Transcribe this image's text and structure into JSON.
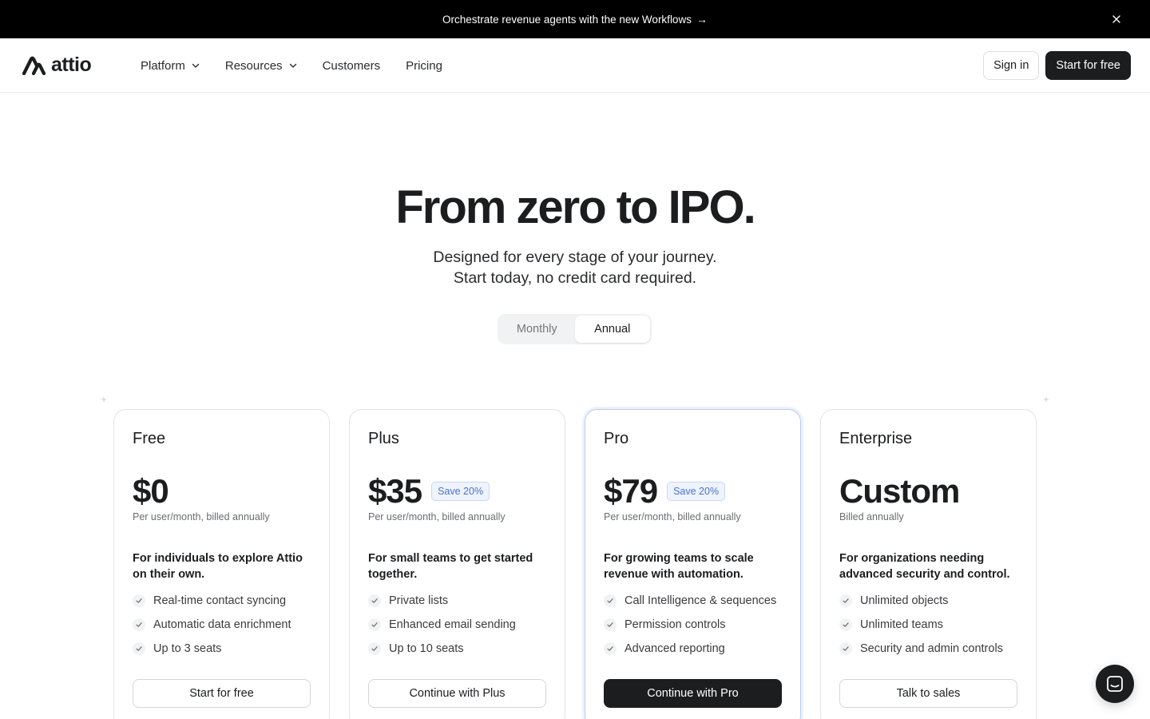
{
  "announcement": {
    "text": "Orchestrate revenue agents with the new Workflows",
    "arrow": "→"
  },
  "nav": {
    "logo_text": "attio",
    "items": [
      {
        "label": "Platform",
        "dropdown": true
      },
      {
        "label": "Resources",
        "dropdown": true
      },
      {
        "label": "Customers",
        "dropdown": false
      },
      {
        "label": "Pricing",
        "dropdown": false
      }
    ],
    "sign_in": "Sign in",
    "start_free": "Start for free"
  },
  "hero": {
    "title": "From zero to IPO.",
    "subtitle_line1": "Designed for every stage of your journey.",
    "subtitle_line2": "Start today, no credit card required."
  },
  "billing_toggle": {
    "options": [
      "Monthly",
      "Annual"
    ],
    "selected": "Annual"
  },
  "plans": [
    {
      "name": "Free",
      "price": "$0",
      "badge": "",
      "billing": "Per user/month, billed annually",
      "description": "For individuals to explore Attio on their own.",
      "features": [
        "Real-time contact syncing",
        "Automatic data enrichment",
        "Up to 3 seats"
      ],
      "cta": "Start for free",
      "featured": false
    },
    {
      "name": "Plus",
      "price": "$35",
      "badge": "Save 20%",
      "billing": "Per user/month, billed annually",
      "description": "For small teams to get started together.",
      "features": [
        "Private lists",
        "Enhanced email sending",
        "Up to 10 seats"
      ],
      "cta": "Continue with Plus",
      "featured": false
    },
    {
      "name": "Pro",
      "price": "$79",
      "badge": "Save 20%",
      "billing": "Per user/month, billed annually",
      "description": "For growing teams to scale revenue with automation.",
      "features": [
        "Call Intelligence & sequences",
        "Permission controls",
        "Advanced reporting"
      ],
      "cta": "Continue with Pro",
      "featured": true
    },
    {
      "name": "Enterprise",
      "price": "Custom",
      "badge": "",
      "billing": "Billed annually",
      "description": "For organizations needing advanced security and control.",
      "features": [
        "Unlimited objects",
        "Unlimited teams",
        "Security and admin controls"
      ],
      "cta": "Talk to sales",
      "featured": false
    }
  ],
  "colors": {
    "accent_badge": "#4a74c9",
    "dark": "#1c1d1f",
    "featured_border": "#b9cdf1"
  }
}
